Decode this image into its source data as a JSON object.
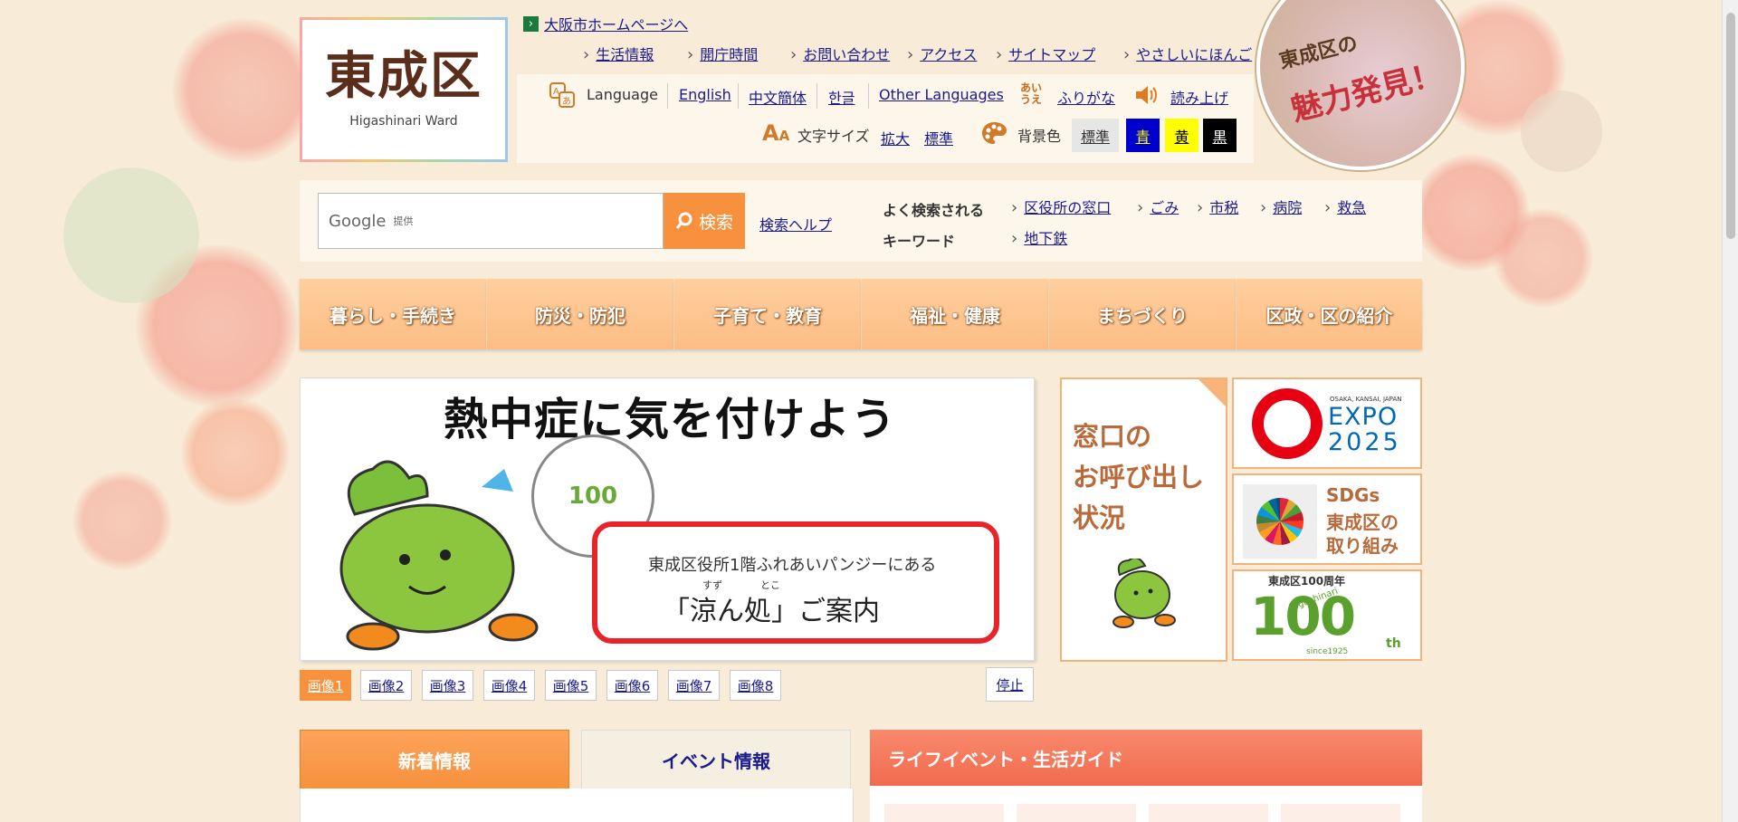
{
  "header": {
    "logo_title": "東成区",
    "logo_subtitle": "Higashinari Ward",
    "osaka_link": "大阪市ホームページへ",
    "top_links": [
      "生活情報",
      "開庁時間",
      "お問い合わせ",
      "アクセス",
      "サイトマップ",
      "やさしいにほんご"
    ],
    "language_label": "Language",
    "languages": [
      "English",
      "中文簡体",
      "한글",
      "Other Languages"
    ],
    "furigana_icon_text": "あい うえ",
    "furigana": "ふりがな",
    "read_aloud": "読み上げ",
    "fontsize_label": "文字サイズ",
    "fontsize_enlarge": "拡大",
    "fontsize_standard": "標準",
    "bgcolor_label": "背景色",
    "bgcolor_options": [
      "標準",
      "青",
      "黄",
      "黒"
    ],
    "badge_line1": "東成区の",
    "badge_line2": "魅力発見！"
  },
  "search": {
    "google_label": "Google",
    "provided": "提供",
    "button": "検索",
    "help": "検索ヘルプ",
    "keywords_label_line1": "よく検索される",
    "keywords_label_line2": "キーワード",
    "keywords": [
      "区役所の窓口",
      "ごみ",
      "市税",
      "病院",
      "救急",
      "地下鉄"
    ]
  },
  "nav": [
    "暮らし・手続き",
    "防災・防犯",
    "子育て・教育",
    "福祉・健康",
    "まちづくり",
    "区政・区の紹介"
  ],
  "slider": {
    "headline": "熱中症に気を付けよう",
    "box_line1": "東成区役所1階ふれあいパンジーにある",
    "box_ruby1": "すず",
    "box_ruby2": "とこ",
    "box_line2": "「涼ん処」ご案内",
    "fan_text": "100",
    "pages": [
      "画像1",
      "画像2",
      "画像3",
      "画像4",
      "画像5",
      "画像6",
      "画像7",
      "画像8"
    ],
    "active_page": 0,
    "stop": "停止"
  },
  "side_banners": {
    "window_call": [
      "窓口の",
      "お呼び出し",
      "状況"
    ],
    "expo_small": "OSAKA, KANSAI, JAPAN",
    "expo": "EXPO",
    "expo_year": "2025",
    "sdgs": [
      "SDGs",
      "東成区の",
      "取り組み"
    ],
    "anniv_title": "東成区100周年",
    "anniv_name": "Higashinari",
    "anniv_since": "since1925",
    "anniv_num": "100",
    "anniv_th": "th"
  },
  "tabs": {
    "news": "新着情報",
    "events": "イベント情報"
  },
  "life_guide": {
    "title": "ライフイベント・生活ガイド"
  },
  "colors": {
    "accent_orange": "#f7913d",
    "nav_bg": "#fdc48f",
    "background": "#f8ecd8",
    "life_guide_red": "#f26a4f"
  }
}
